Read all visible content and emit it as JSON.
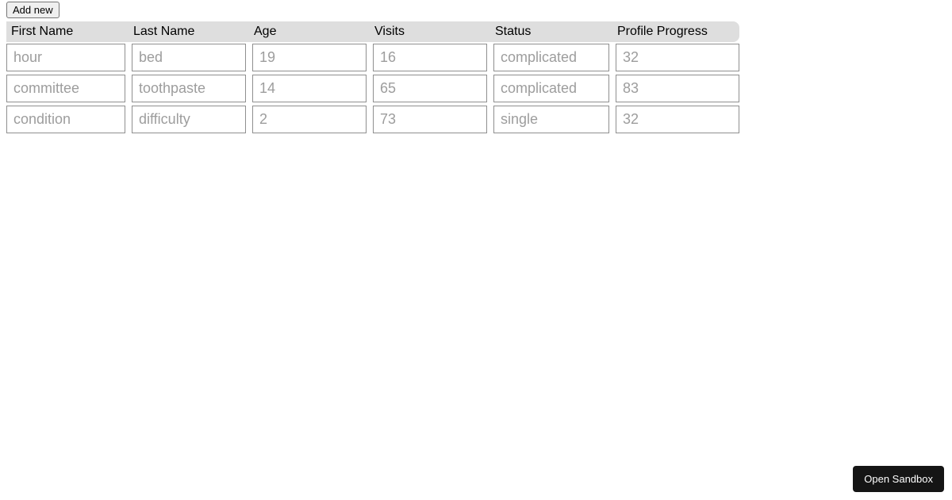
{
  "toolbar": {
    "add_label": "Add new"
  },
  "table": {
    "headers": [
      "First Name",
      "Last Name",
      "Age",
      "Visits",
      "Status",
      "Profile Progress"
    ],
    "rows": [
      {
        "firstName": "hour",
        "lastName": "bed",
        "age": "19",
        "visits": "16",
        "status": "complicated",
        "progress": "32"
      },
      {
        "firstName": "committee",
        "lastName": "toothpaste",
        "age": "14",
        "visits": "65",
        "status": "complicated",
        "progress": "83"
      },
      {
        "firstName": "condition",
        "lastName": "difficulty",
        "age": "2",
        "visits": "73",
        "status": "single",
        "progress": "32"
      }
    ]
  },
  "footer": {
    "sandbox_label": "Open Sandbox"
  }
}
